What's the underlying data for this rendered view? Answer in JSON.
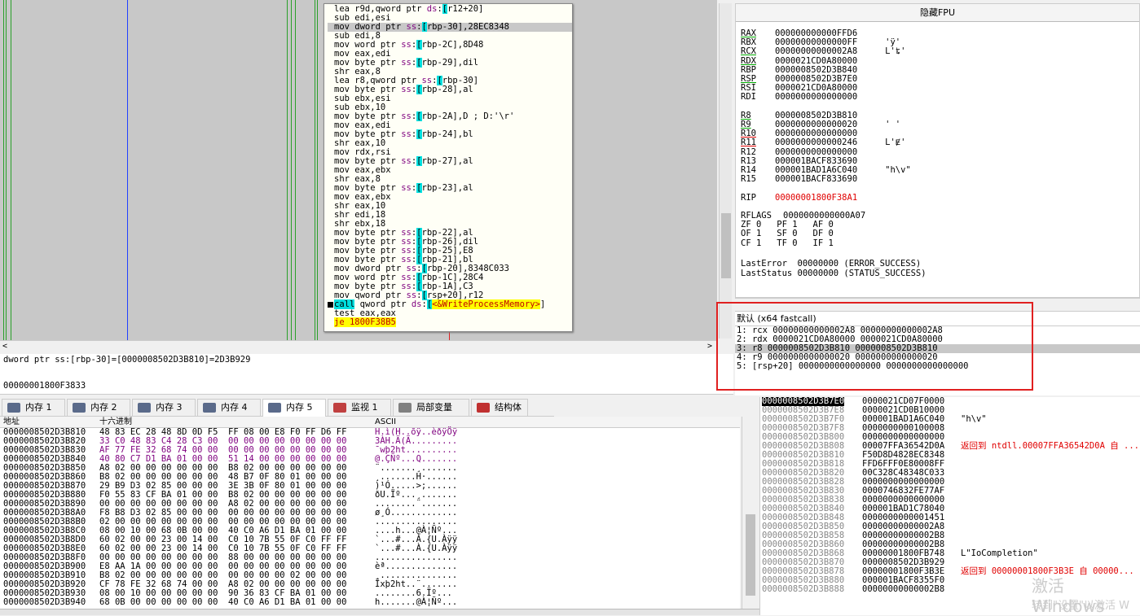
{
  "code": [
    {
      "t": "lea r9d,qword ptr ds:[r12+20]",
      "hl": false
    },
    {
      "t": "sub edi,esi",
      "hl": false
    },
    {
      "t": "mov dword ptr ss:[rbp-30],28EC8348",
      "hl": true
    },
    {
      "t": "sub edi,8",
      "hl": false
    },
    {
      "t": "mov word ptr ss:[rbp-2C],8D48",
      "hl": false
    },
    {
      "t": "mov eax,edi",
      "hl": false
    },
    {
      "t": "mov byte ptr ss:[rbp-29],dil",
      "hl": false
    },
    {
      "t": "shr eax,8",
      "hl": false
    },
    {
      "t": "lea r8,qword ptr ss:[rbp-30]",
      "hl": false
    },
    {
      "t": "mov byte ptr ss:[rbp-28],al",
      "hl": false
    },
    {
      "t": "sub ebx,esi",
      "hl": false
    },
    {
      "t": "sub ebx,10",
      "hl": false
    },
    {
      "t": "mov byte ptr ss:[rbp-2A],D ; D:'\\r'",
      "hl": false
    },
    {
      "t": "mov eax,edi",
      "hl": false
    },
    {
      "t": "mov byte ptr ss:[rbp-24],bl",
      "hl": false
    },
    {
      "t": "shr eax,10",
      "hl": false
    },
    {
      "t": "mov rdx,rsi",
      "hl": false
    },
    {
      "t": "mov byte ptr ss:[rbp-27],al",
      "hl": false
    },
    {
      "t": "mov eax,ebx",
      "hl": false
    },
    {
      "t": "shr eax,8",
      "hl": false
    },
    {
      "t": "mov byte ptr ss:[rbp-23],al",
      "hl": false
    },
    {
      "t": "mov eax,ebx",
      "hl": false
    },
    {
      "t": "shr eax,10",
      "hl": false
    },
    {
      "t": "shr edi,18",
      "hl": false
    },
    {
      "t": "shr ebx,18",
      "hl": false
    },
    {
      "t": "mov byte ptr ss:[rbp-22],al",
      "hl": false
    },
    {
      "t": "mov byte ptr ss:[rbp-26],dil",
      "hl": false
    },
    {
      "t": "mov byte ptr ss:[rbp-25],E8",
      "hl": false
    },
    {
      "t": "mov byte ptr ss:[rbp-21],bl",
      "hl": false
    },
    {
      "t": "mov dword ptr ss:[rbp-20],8348C033",
      "hl": false
    },
    {
      "t": "mov word ptr ss:[rbp-1C],28C4",
      "hl": false
    },
    {
      "t": "mov byte ptr ss:[rbp-1A],C3",
      "hl": false
    },
    {
      "t": "mov qword ptr ss:[rsp+20],r12",
      "hl": false
    },
    {
      "t": "call qword ptr ds:[<&WriteProcessMemory>]",
      "hl": false,
      "bp": true
    },
    {
      "t": "test eax,eax",
      "hl": false
    },
    {
      "t": "je 1800F38B5",
      "hl": false
    }
  ],
  "info": {
    "line1": "dword ptr ss:[rbp-30]=[0000008502D3B810]=2D3B929",
    "line2": "00000001800F3833"
  },
  "registers": {
    "header": "隐藏FPU",
    "rows": [
      {
        "n": "RAX",
        "v": "000000000000FFD6",
        "c": "",
        "u": "g"
      },
      {
        "n": "RBX",
        "v": "00000000000000FF",
        "c": "'ÿ'",
        "u": ""
      },
      {
        "n": "RCX",
        "v": "00000000000002A8",
        "c": "L'ʨ'",
        "u": "g"
      },
      {
        "n": "RDX",
        "v": "0000021CD0A80000",
        "c": "",
        "u": "g"
      },
      {
        "n": "RBP",
        "v": "0000008502D3B840",
        "c": "",
        "u": ""
      },
      {
        "n": "RSP",
        "v": "0000008502D3B7E0",
        "c": "",
        "u": "g"
      },
      {
        "n": "RSI",
        "v": "0000021CD0A80000",
        "c": "",
        "u": ""
      },
      {
        "n": "RDI",
        "v": "0000000000000000",
        "c": "",
        "u": ""
      },
      {
        "n": "",
        "v": "",
        "c": "",
        "u": ""
      },
      {
        "n": "R8",
        "v": "0000008502D3B810",
        "c": "",
        "u": "g"
      },
      {
        "n": "R9",
        "v": "0000000000000020",
        "c": "' '",
        "u": "g"
      },
      {
        "n": "R10",
        "v": "0000000000000000",
        "c": "",
        "u": "r"
      },
      {
        "n": "R11",
        "v": "0000000000000246",
        "c": "L'Ɇ'",
        "u": "r"
      },
      {
        "n": "R12",
        "v": "0000000000000000",
        "c": "",
        "u": ""
      },
      {
        "n": "R13",
        "v": "000001BACF833690",
        "c": "",
        "u": ""
      },
      {
        "n": "R14",
        "v": "000001BAD1A6C040",
        "c": "\"h\\v\"",
        "u": ""
      },
      {
        "n": "R15",
        "v": "000001BACF833690",
        "c": "",
        "u": ""
      },
      {
        "n": "",
        "v": "",
        "c": "",
        "u": ""
      },
      {
        "n": "RIP",
        "v": "00000001800F38A1",
        "c": "",
        "u": "",
        "red": true
      },
      {
        "n": "",
        "v": "",
        "c": "",
        "u": ""
      },
      {
        "n": "RFLAGS",
        "v": "0000000000000A07",
        "c": "",
        "u": ""
      }
    ],
    "flags": [
      "ZF 0   PF 1   AF 0",
      "OF 1   SF 0   DF 0",
      "CF 1   TF 0   IF 1"
    ],
    "last_error": "LastError  00000000 (ERROR_SUCCESS)",
    "last_status": "LastStatus 00000000 (STATUS_SUCCESS)"
  },
  "args": {
    "header": "默认 (x64 fastcall)",
    "rows": [
      {
        "t": "1: rcx 00000000000002A8 00000000000002A8",
        "hl": false
      },
      {
        "t": "2: rdx 0000021CD0A80000 0000021CD0A80000",
        "hl": false
      },
      {
        "t": "3: r8 0000008502D3B810 0000008502D3B810",
        "hl": true
      },
      {
        "t": "4: r9 0000000000000020 0000000000000020",
        "hl": false
      },
      {
        "t": "5: [rsp+20] 0000000000000000 0000000000000000",
        "hl": false
      }
    ]
  },
  "tabs": [
    {
      "label": "内存 1",
      "icon": "memory-icon"
    },
    {
      "label": "内存 2",
      "icon": "memory-icon"
    },
    {
      "label": "内存 3",
      "icon": "memory-icon"
    },
    {
      "label": "内存 4",
      "icon": "memory-icon"
    },
    {
      "label": "内存 5",
      "icon": "memory-icon",
      "active": true
    },
    {
      "label": "监视 1",
      "icon": "watch-icon"
    },
    {
      "label": "局部变量",
      "icon": "locals-icon"
    },
    {
      "label": "结构体",
      "icon": "struct-icon"
    }
  ],
  "dump": {
    "col_addr": "地址",
    "col_hex": "十六进制",
    "col_ascii": "ASCII",
    "rows": [
      {
        "a": "0000008502D3B810",
        "h": "48 83 EC 28 48 8D 0D F5  FF 08 00 E8 F0 FF D6 FF",
        "s": "H.ì(H..õÿ..èðÿÖÿ"
      },
      {
        "a": "0000008502D3B820",
        "h": "33 C0 48 83 C4 28 C3 00  00 00 00 00 00 00 00 00",
        "s": "3ÀH.Ä(Ã........."
      },
      {
        "a": "0000008502D3B830",
        "h": "AF 77 FE 32 68 74 00 00  00 00 00 00 00 00 00 00",
        "s": "¯wþ2ht.........."
      },
      {
        "a": "0000008502D3B840",
        "h": "40 80 C7 D1 BA 01 00 00  51 14 00 00 00 00 00 00",
        "s": "@.ÇÑº...Q......."
      },
      {
        "a": "0000008502D3B850",
        "h": "A8 02 00 00 00 00 00 00  B8 02 00 00 00 00 00 00",
        "s": "¨.......¸......."
      },
      {
        "a": "0000008502D3B860",
        "h": "B8 02 00 00 00 00 00 00  48 B7 0F 80 01 00 00 00",
        "s": "¸.......H·......"
      },
      {
        "a": "0000008502D3B870",
        "h": "29 B9 D3 02 85 00 00 00  3E 3B 0F 80 01 00 00 00",
        "s": ")¹Ó.....>;......"
      },
      {
        "a": "0000008502D3B880",
        "h": "F0 55 83 CF BA 01 00 00  B8 02 00 00 00 00 00 00",
        "s": "ðU.Ïº...¸......."
      },
      {
        "a": "0000008502D3B890",
        "h": "00 00 00 00 00 00 00 00  A8 02 00 00 00 00 00 00",
        "s": "........¨......."
      },
      {
        "a": "0000008502D3B8A0",
        "h": "F8 B8 D3 02 85 00 00 00  00 00 00 00 00 00 00 00",
        "s": "ø¸Ó............."
      },
      {
        "a": "0000008502D3B8B0",
        "h": "02 00 00 00 00 00 00 00  00 00 00 00 00 00 00 00",
        "s": "................"
      },
      {
        "a": "0000008502D3B8C0",
        "h": "08 00 10 00 68 0B 00 00  40 C0 A6 D1 BA 01 00 00",
        "s": "....h...@À¦Ñº..."
      },
      {
        "a": "0000008502D3B8D0",
        "h": "60 02 00 00 23 00 14 00  C0 10 7B 55 0F C0 FF FF",
        "s": "`...#...À.{U.Àÿÿ"
      },
      {
        "a": "0000008502D3B8E0",
        "h": "60 02 00 00 23 00 14 00  C0 10 7B 55 0F C0 FF FF",
        "s": "`...#...À.{U.Àÿÿ"
      },
      {
        "a": "0000008502D3B8F0",
        "h": "00 00 00 00 00 00 00 00  88 00 00 00 00 00 00 00",
        "s": "................"
      },
      {
        "a": "0000008502D3B900",
        "h": "E8 AA 1A 00 00 00 00 00  00 00 00 00 00 00 00 00",
        "s": "èª.............."
      },
      {
        "a": "0000008502D3B910",
        "h": "B8 02 00 00 00 00 00 00  00 00 00 00 02 00 00 00",
        "s": "¸..............."
      },
      {
        "a": "0000008502D3B920",
        "h": "CF 78 FE 32 68 74 00 00  A8 02 00 00 00 00 00 00",
        "s": "Ïxþ2ht..¨......."
      },
      {
        "a": "0000008502D3B930",
        "h": "08 00 10 00 00 00 00 00  90 36 83 CF BA 01 00 00",
        "s": "........6.Ïº..."
      },
      {
        "a": "0000008502D3B940",
        "h": "68 0B 00 00 00 00 00 00  40 C0 A6 D1 BA 01 00 00",
        "s": "h.......@À¦Ñº..."
      }
    ]
  },
  "stack": [
    {
      "a": "0000008502D3B7E0",
      "v": "0000021CD07F0000",
      "c": "",
      "sel": true
    },
    {
      "a": "0000008502D3B7E8",
      "v": "0000021CD0B10000",
      "c": ""
    },
    {
      "a": "0000008502D3B7F0",
      "v": "000001BAD1A6C040",
      "c": "\"h\\v\""
    },
    {
      "a": "0000008502D3B7F8",
      "v": "0000000000100008",
      "c": ""
    },
    {
      "a": "0000008502D3B800",
      "v": "0000000000000000",
      "c": ""
    },
    {
      "a": "0000008502D3B808",
      "v": "00007FFA36542D0A",
      "c": "返回到 ntdll.00007FFA36542D0A 自 ...",
      "red": true
    },
    {
      "a": "0000008502D3B810",
      "v": "F50D8D4828EC8348",
      "c": ""
    },
    {
      "a": "0000008502D3B818",
      "v": "FFD6FFF0E80008FF",
      "c": ""
    },
    {
      "a": "0000008502D3B820",
      "v": "00C328C48348C033",
      "c": ""
    },
    {
      "a": "0000008502D3B828",
      "v": "0000000000000000",
      "c": ""
    },
    {
      "a": "0000008502D3B830",
      "v": "0000746832FE77AF",
      "c": ""
    },
    {
      "a": "0000008502D3B838",
      "v": "0000000000000000",
      "c": ""
    },
    {
      "a": "0000008502D3B840",
      "v": "000001BAD1C78040",
      "c": ""
    },
    {
      "a": "0000008502D3B848",
      "v": "0000000000001451",
      "c": ""
    },
    {
      "a": "0000008502D3B850",
      "v": "00000000000002A8",
      "c": ""
    },
    {
      "a": "0000008502D3B858",
      "v": "00000000000002B8",
      "c": ""
    },
    {
      "a": "0000008502D3B860",
      "v": "00000000000002B8",
      "c": ""
    },
    {
      "a": "0000008502D3B868",
      "v": "00000001800FB748",
      "c": "L\"IoCompletion\""
    },
    {
      "a": "0000008502D3B870",
      "v": "0000008502D3B929",
      "c": ""
    },
    {
      "a": "0000008502D3B878",
      "v": "00000001800F3B3E",
      "c": "返回到 00000001800F3B3E 自 00000...",
      "red": true
    },
    {
      "a": "0000008502D3B880",
      "v": "000001BACF8355F0",
      "c": ""
    },
    {
      "a": "0000008502D3B888",
      "v": "00000000000002B8",
      "c": ""
    }
  ],
  "watermark": {
    "l1": "激活 Windows",
    "l2": "转到\"设置\"以激活 W"
  }
}
